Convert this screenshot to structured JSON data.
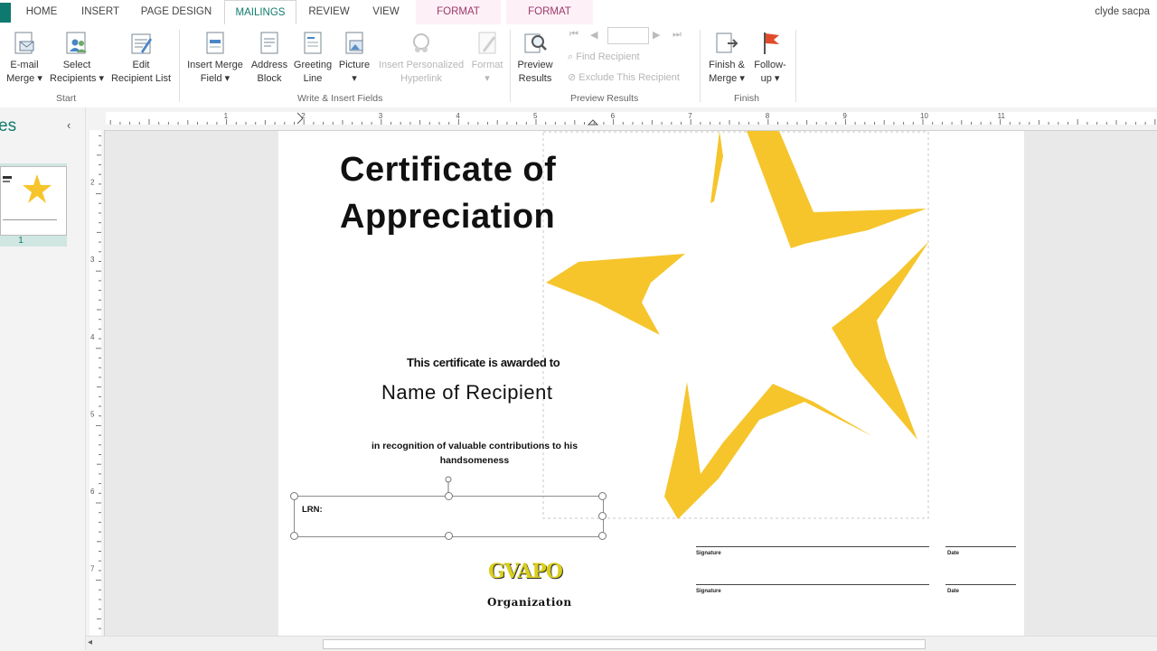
{
  "tabs": [
    {
      "label": "HOME"
    },
    {
      "label": "INSERT"
    },
    {
      "label": "PAGE DESIGN"
    },
    {
      "label": "MAILINGS",
      "active": true
    },
    {
      "label": "REVIEW"
    },
    {
      "label": "VIEW"
    },
    {
      "label": "FORMAT",
      "contextual": true
    },
    {
      "label": "FORMAT",
      "contextual": true
    }
  ],
  "user": "clyde sacpa",
  "ribbon": {
    "start": {
      "label": "Start",
      "email_merge": [
        "E-mail",
        "Merge ▾"
      ],
      "select_recipients": [
        "Select",
        "Recipients ▾"
      ],
      "edit_recipient_list": [
        "Edit",
        "Recipient List"
      ]
    },
    "write_insert": {
      "label": "Write & Insert Fields",
      "insert_merge_field": [
        "Insert Merge",
        "Field ▾"
      ],
      "address_block": [
        "Address",
        "Block"
      ],
      "greeting_line": [
        "Greeting",
        "Line"
      ],
      "picture": [
        "Picture",
        "▾"
      ],
      "insert_personalized_hyperlink": [
        "Insert Personalized",
        "Hyperlink"
      ],
      "format": [
        "Format",
        "▾"
      ]
    },
    "preview": {
      "label": "Preview Results",
      "preview_results": [
        "Preview",
        "Results"
      ],
      "record_value": "",
      "find_recipient": "Find Recipient",
      "exclude_recipient": "Exclude This Recipient"
    },
    "finish": {
      "label": "Finish",
      "finish_merge": [
        "Finish &",
        "Merge ▾"
      ],
      "follow_up": [
        "Follow-",
        "up ▾"
      ]
    }
  },
  "left_pane": {
    "title": "es",
    "page_number": "1"
  },
  "ruler": {
    "h_numbers": [
      "1",
      "2",
      "3",
      "4",
      "5",
      "6",
      "7",
      "8",
      "9",
      "10",
      "11"
    ],
    "v_numbers": [
      "2",
      "3",
      "4",
      "5",
      "6",
      "7"
    ]
  },
  "certificate": {
    "title_line1": "Certificate of",
    "title_line2": "Appreciation",
    "awarded_text": "This certificate is awarded to",
    "recipient": "Name of Recipient",
    "recognition_line1": "in recognition of valuable contributions to his",
    "recognition_line2": "handsomeness",
    "lrn_label": "LRN:",
    "org_logo_text": "GVAPO",
    "org_name": "Organization",
    "signature_label": "Signature",
    "date_label": "Date"
  },
  "colors": {
    "accent": "#0f7b6c",
    "star": "#f6c52c",
    "contextual_tab": "#fdf0f6"
  }
}
